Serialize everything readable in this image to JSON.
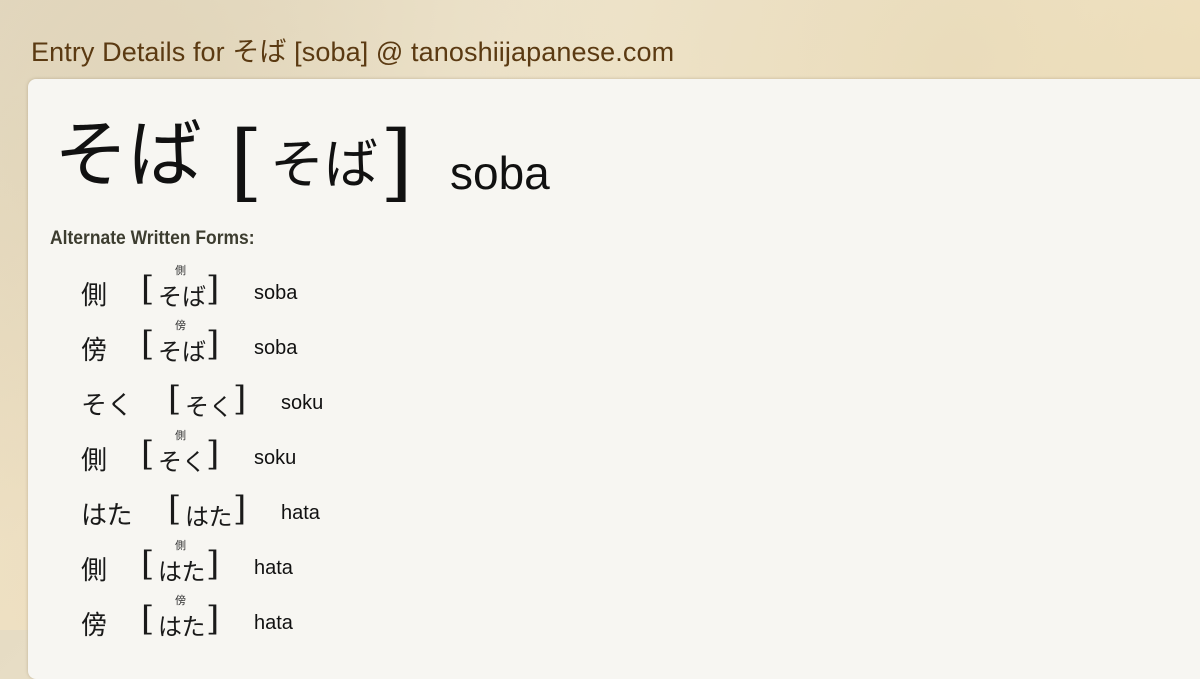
{
  "header": {
    "title": "Entry Details for そば [soba] @ tanoshiijapanese.com"
  },
  "entry": {
    "word": "そば",
    "reading": "そば",
    "bracket_open": "[",
    "bracket_close": "]",
    "romaji": "soba"
  },
  "alternate": {
    "title": "Alternate Written Forms:",
    "rows": [
      {
        "form": "側",
        "ruby": "側",
        "reading": "そば",
        "romaji": "soba"
      },
      {
        "form": "傍",
        "ruby": "傍",
        "reading": "そば",
        "romaji": "soba"
      },
      {
        "form": "そく",
        "ruby": "",
        "reading": "そく",
        "romaji": "soku"
      },
      {
        "form": "側",
        "ruby": "側",
        "reading": "そく",
        "romaji": "soku"
      },
      {
        "form": "はた",
        "ruby": "",
        "reading": "はた",
        "romaji": "hata"
      },
      {
        "form": "側",
        "ruby": "側",
        "reading": "はた",
        "romaji": "hata"
      },
      {
        "form": "傍",
        "ruby": "傍",
        "reading": "はた",
        "romaji": "hata"
      }
    ]
  }
}
